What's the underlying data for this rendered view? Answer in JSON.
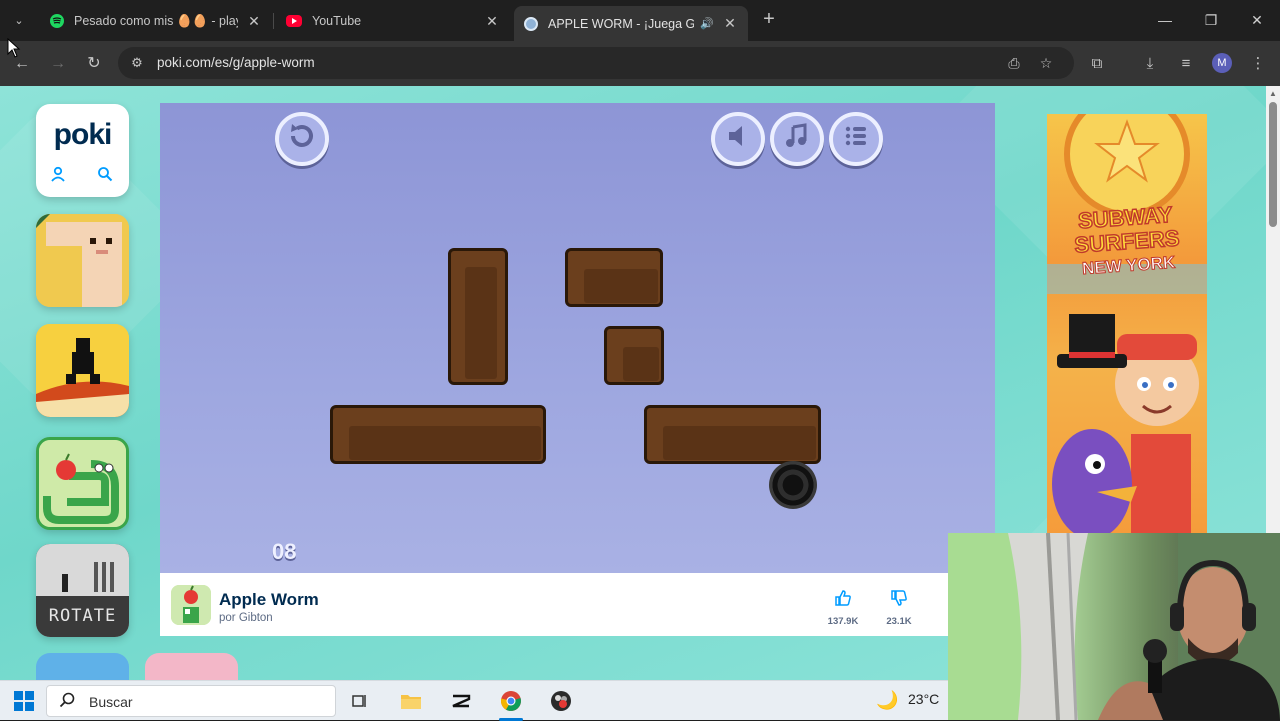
{
  "browser": {
    "tabs": [
      {
        "title": "Pesado como mis 🥚🥚 - playli",
        "favicon": "spotify-icon",
        "active": false
      },
      {
        "title": "YouTube",
        "favicon": "youtube-icon",
        "active": false
      },
      {
        "title": "APPLE WORM - ¡Juega Grat",
        "favicon": "poki-favicon",
        "active": true,
        "audio": true
      }
    ],
    "url": "poki.com/es/g/apple-worm",
    "avatar_letter": "M",
    "colors": {
      "frame": "#1f1f1f",
      "toolbar": "#353535",
      "omnibox": "#282828"
    }
  },
  "page": {
    "logo": {
      "text_p": "p",
      "text_o": "o",
      "text_ki": "ki"
    },
    "sidebar_tiles": [
      "snake-game-tile",
      "dark-runner-tile",
      "apple-worm-tile",
      "rotate-game-tile"
    ],
    "rotate_tile_text": "ROTATE",
    "game": {
      "level": "08",
      "colors": {
        "background": "#9ea7e0",
        "dirt": "#6b3f1d",
        "outline": "#2a1808"
      }
    },
    "game_info": {
      "title": "Apple Worm",
      "author": "por Gibton",
      "likes": "137.9K",
      "dislikes": "23.1K"
    },
    "ad": {
      "title_line1": "SUBWAY",
      "title_line2": "SURFERS",
      "title_line3": "NEW YORK"
    }
  },
  "taskbar": {
    "search_placeholder": "Buscar",
    "weather": "23°C"
  }
}
